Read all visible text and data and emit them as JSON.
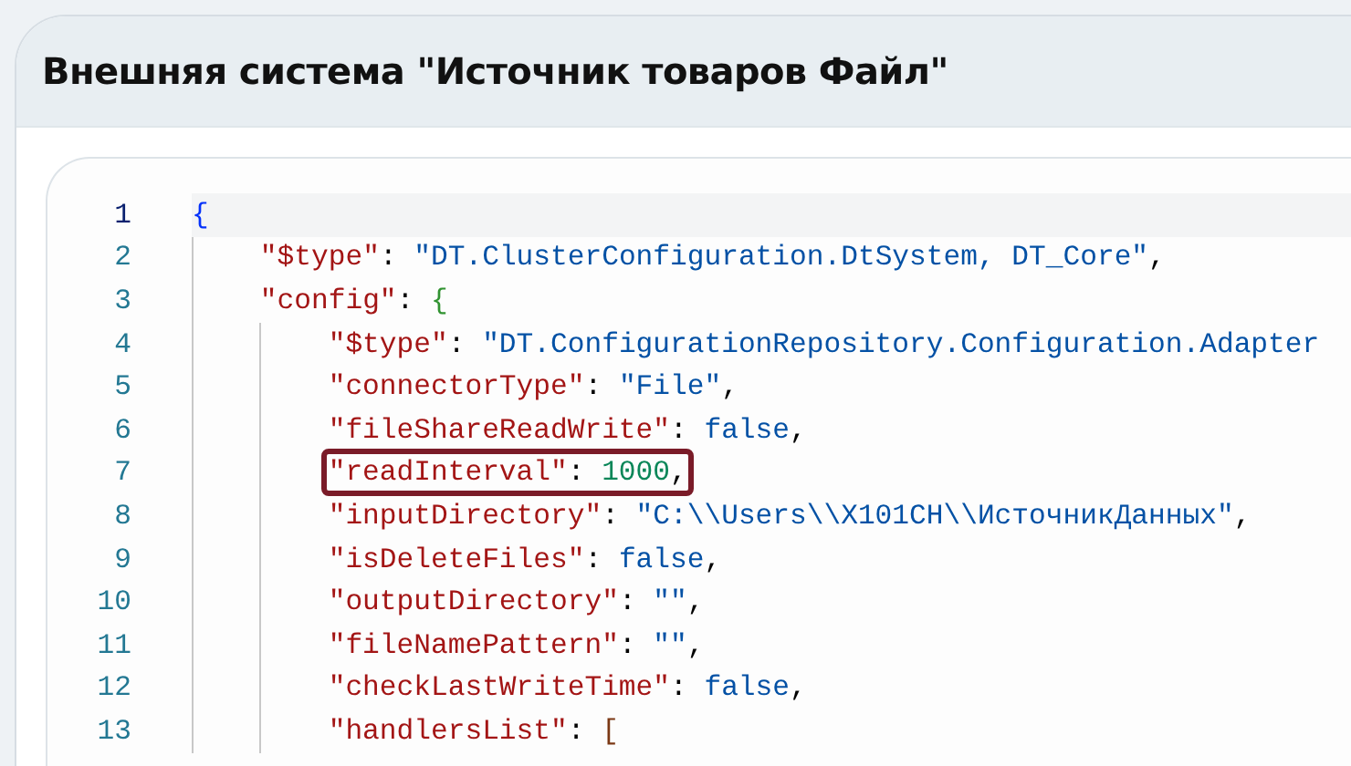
{
  "title": "Внешняя система \"Источник товаров Файл\"",
  "code_lines": [
    {
      "number": "1",
      "active": true,
      "highlighted": false,
      "tokens": [
        {
          "kind": "open",
          "text": "{"
        }
      ]
    },
    {
      "number": "2",
      "active": false,
      "highlighted": false,
      "tokens": [
        {
          "kind": "key",
          "text": "\"$type\""
        },
        {
          "kind": "punct",
          "text": ": "
        },
        {
          "kind": "string",
          "text": "\"DT.ClusterConfiguration.DtSystem, DT_Core\""
        },
        {
          "kind": "punct",
          "text": ","
        }
      ]
    },
    {
      "number": "3",
      "active": false,
      "highlighted": false,
      "tokens": [
        {
          "kind": "key",
          "text": "\"config\""
        },
        {
          "kind": "punct",
          "text": ": "
        },
        {
          "kind": "open",
          "text": "{"
        }
      ]
    },
    {
      "number": "4",
      "active": false,
      "highlighted": false,
      "tokens": [
        {
          "kind": "key",
          "text": "\"$type\""
        },
        {
          "kind": "punct",
          "text": ": "
        },
        {
          "kind": "string",
          "text": "\"DT.ConfigurationRepository.Configuration.Adapter"
        }
      ]
    },
    {
      "number": "5",
      "active": false,
      "highlighted": false,
      "tokens": [
        {
          "kind": "key",
          "text": "\"connectorType\""
        },
        {
          "kind": "punct",
          "text": ": "
        },
        {
          "kind": "string",
          "text": "\"File\""
        },
        {
          "kind": "punct",
          "text": ","
        }
      ]
    },
    {
      "number": "6",
      "active": false,
      "highlighted": false,
      "tokens": [
        {
          "kind": "key",
          "text": "\"fileShareReadWrite\""
        },
        {
          "kind": "punct",
          "text": ": "
        },
        {
          "kind": "keyword",
          "text": "false"
        },
        {
          "kind": "punct",
          "text": ","
        }
      ]
    },
    {
      "number": "7",
      "active": false,
      "highlighted": true,
      "tokens": [
        {
          "kind": "key",
          "text": "\"readInterval\""
        },
        {
          "kind": "punct",
          "text": ": "
        },
        {
          "kind": "number",
          "text": "1000"
        },
        {
          "kind": "punct",
          "text": ","
        }
      ]
    },
    {
      "number": "8",
      "active": false,
      "highlighted": false,
      "tokens": [
        {
          "kind": "key",
          "text": "\"inputDirectory\""
        },
        {
          "kind": "punct",
          "text": ": "
        },
        {
          "kind": "string",
          "text": "\"C:\\\\Users\\\\X101CH\\\\ИсточникДанных\""
        },
        {
          "kind": "punct",
          "text": ","
        }
      ]
    },
    {
      "number": "9",
      "active": false,
      "highlighted": false,
      "tokens": [
        {
          "kind": "key",
          "text": "\"isDeleteFiles\""
        },
        {
          "kind": "punct",
          "text": ": "
        },
        {
          "kind": "keyword",
          "text": "false"
        },
        {
          "kind": "punct",
          "text": ","
        }
      ]
    },
    {
      "number": "10",
      "active": false,
      "highlighted": false,
      "tokens": [
        {
          "kind": "key",
          "text": "\"outputDirectory\""
        },
        {
          "kind": "punct",
          "text": ": "
        },
        {
          "kind": "string",
          "text": "\"\""
        },
        {
          "kind": "punct",
          "text": ","
        }
      ]
    },
    {
      "number": "11",
      "active": false,
      "highlighted": false,
      "tokens": [
        {
          "kind": "key",
          "text": "\"fileNamePattern\""
        },
        {
          "kind": "punct",
          "text": ": "
        },
        {
          "kind": "string",
          "text": "\"\""
        },
        {
          "kind": "punct",
          "text": ","
        }
      ]
    },
    {
      "number": "12",
      "active": false,
      "highlighted": false,
      "tokens": [
        {
          "kind": "key",
          "text": "\"checkLastWriteTime\""
        },
        {
          "kind": "punct",
          "text": ": "
        },
        {
          "kind": "keyword",
          "text": "false"
        },
        {
          "kind": "punct",
          "text": ","
        }
      ]
    },
    {
      "number": "13",
      "active": false,
      "highlighted": false,
      "tokens": [
        {
          "kind": "key",
          "text": "\"handlersList\""
        },
        {
          "kind": "punct",
          "text": ": "
        },
        {
          "kind": "open",
          "text": "["
        }
      ]
    }
  ]
}
